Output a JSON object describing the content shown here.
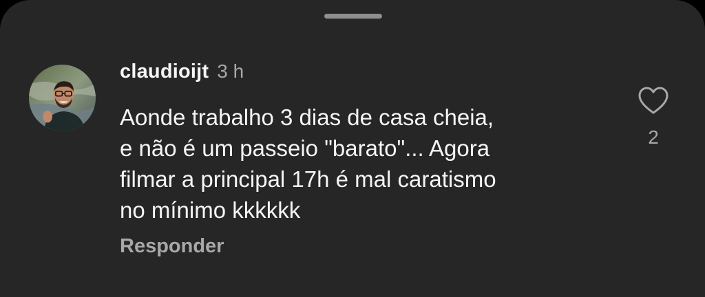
{
  "comment": {
    "username": "claudioijt",
    "timestamp": "3 h",
    "text": "Aonde trabalho 3 dias de casa cheia,\ne não é um passeio \"barato\"... Agora\nfilmar a principal 17h é mal caratismo\nno mínimo kkkkkk",
    "reply_label": "Responder",
    "like_count": "2"
  },
  "icons": {
    "like": "heart-outline-icon",
    "avatar": "profile-photo"
  },
  "colors": {
    "sheet_background": "#262626",
    "primary_text": "#f5f5f5",
    "secondary_text": "#a8a8a8"
  }
}
